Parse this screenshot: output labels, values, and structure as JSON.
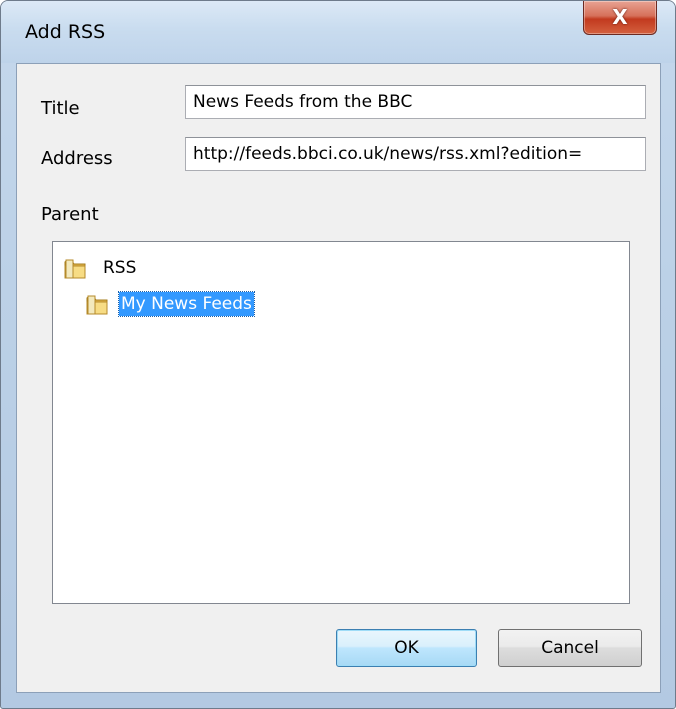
{
  "window": {
    "title": "Add RSS",
    "close_glyph": "X"
  },
  "form": {
    "title_label": "Title",
    "title_value": "News Feeds from the BBC",
    "address_label": "Address",
    "address_value": "http://feeds.bbci.co.uk/news/rss.xml?edition=",
    "parent_label": "Parent"
  },
  "tree": {
    "items": [
      {
        "label": "RSS",
        "icon": "folder-icon",
        "level": 0,
        "selected": false
      },
      {
        "label": "My News Feeds",
        "icon": "folder-icon",
        "level": 1,
        "selected": true
      }
    ]
  },
  "buttons": {
    "ok_label": "OK",
    "cancel_label": "Cancel"
  },
  "colors": {
    "selection": "#3399ff",
    "close_button": "#c23a1f",
    "default_button_border": "#3c7fb1"
  }
}
